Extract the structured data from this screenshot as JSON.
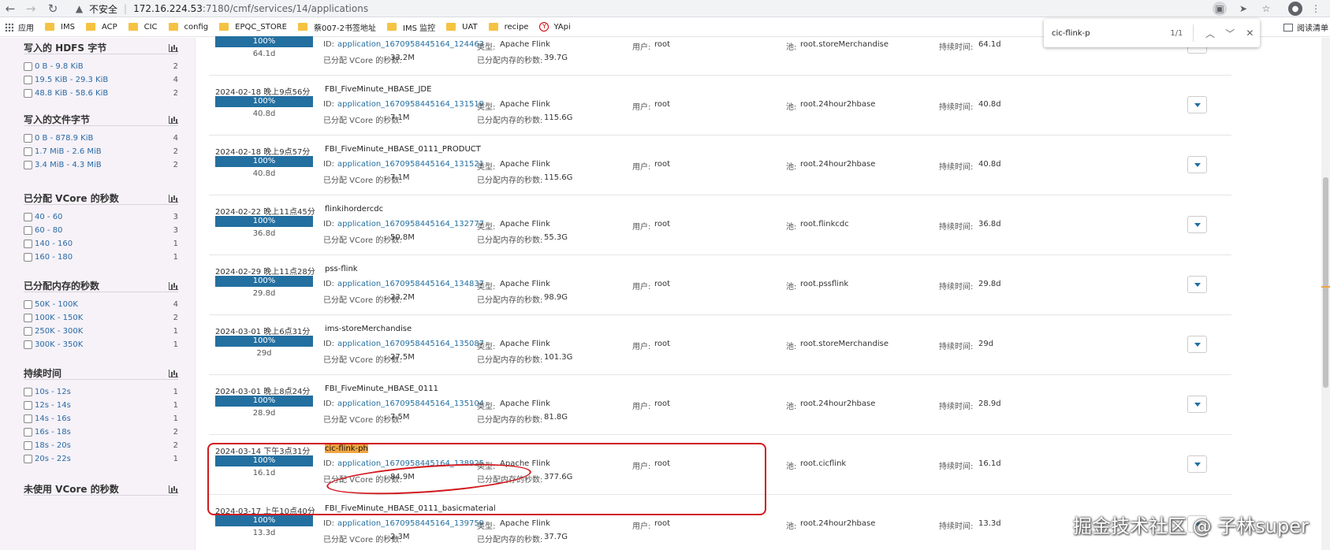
{
  "browser": {
    "insecure_label": "不安全",
    "url_host": "172.16.224.53",
    "url_path": ":7180/cmf/services/14/applications",
    "bookmarks": [
      {
        "label": "应用",
        "icon": "apps-grid-icon"
      },
      {
        "label": "IMS",
        "icon": "folder-icon"
      },
      {
        "label": "ACP",
        "icon": "folder-icon"
      },
      {
        "label": "CIC",
        "icon": "folder-icon"
      },
      {
        "label": "config",
        "icon": "folder-icon"
      },
      {
        "label": "EPQC_STORE",
        "icon": "folder-icon"
      },
      {
        "label": "蔡007-2书签地址",
        "icon": "folder-icon"
      },
      {
        "label": "IMS 监控",
        "icon": "folder-icon"
      },
      {
        "label": "UAT",
        "icon": "folder-icon"
      },
      {
        "label": "recipe",
        "icon": "folder-icon"
      },
      {
        "label": "YApi",
        "icon": "yapi-icon"
      }
    ],
    "reading_list": "阅读清单",
    "find": {
      "query": "cic-flink-p",
      "count": "1/1"
    }
  },
  "facets": [
    {
      "title": "写入的 HDFS 字节",
      "items": [
        {
          "label": "0 B - 9.8 KiB",
          "count": "2"
        },
        {
          "label": "19.5 KiB - 29.3 KiB",
          "count": "4"
        },
        {
          "label": "48.8 KiB - 58.6 KiB",
          "count": "2"
        }
      ]
    },
    {
      "title": "写入的文件字节",
      "items": [
        {
          "label": "0 B - 878.9 KiB",
          "count": "4"
        },
        {
          "label": "1.7 MiB - 2.6 MiB",
          "count": "2"
        },
        {
          "label": "3.4 MiB - 4.3 MiB",
          "count": "2"
        }
      ]
    },
    {
      "title": "已分配 VCore 的秒数",
      "items": [
        {
          "label": "40 - 60",
          "count": "3"
        },
        {
          "label": "60 - 80",
          "count": "3"
        },
        {
          "label": "140 - 160",
          "count": "1"
        },
        {
          "label": "160 - 180",
          "count": "1"
        }
      ]
    },
    {
      "title": "已分配内存的秒数",
      "items": [
        {
          "label": "50K - 100K",
          "count": "4"
        },
        {
          "label": "100K - 150K",
          "count": "2"
        },
        {
          "label": "250K - 300K",
          "count": "1"
        },
        {
          "label": "300K - 350K",
          "count": "1"
        }
      ]
    },
    {
      "title": "持续时间",
      "items": [
        {
          "label": "10s - 12s",
          "count": "1"
        },
        {
          "label": "12s - 14s",
          "count": "1"
        },
        {
          "label": "14s - 16s",
          "count": "1"
        },
        {
          "label": "16s - 18s",
          "count": "2"
        },
        {
          "label": "18s - 20s",
          "count": "2"
        },
        {
          "label": "20s - 22s",
          "count": "1"
        }
      ]
    },
    {
      "title": "未使用 VCore 的秒数",
      "items": []
    }
  ],
  "labels": {
    "id": "ID:",
    "type": "类型:",
    "vcore": "已分配 VCore 的秒数:",
    "memory": "已分配内存的秒数:",
    "user": "用户:",
    "pool": "池:",
    "duration": "持续时间:"
  },
  "apps": [
    {
      "start": "",
      "progress": "100%",
      "progress_value": 100,
      "elapsed": "64.1d",
      "name": "",
      "id": "application_1670958445164_124463",
      "type": "Apache Flink",
      "vcore": "33.2M",
      "memory": "39.7G",
      "user": "root",
      "pool": "root.storeMerchandise",
      "duration": "64.1d"
    },
    {
      "start": "2024-02-18 晚上9点56分",
      "progress": "100%",
      "progress_value": 100,
      "elapsed": "40.8d",
      "name": "FBI_FiveMinute_HBASE_JDE",
      "id": "application_1670958445164_131519",
      "type": "Apache Flink",
      "vcore": "7.1M",
      "memory": "115.6G",
      "user": "root",
      "pool": "root.24hour2hbase",
      "duration": "40.8d"
    },
    {
      "start": "2024-02-18 晚上9点57分",
      "progress": "100%",
      "progress_value": 100,
      "elapsed": "40.8d",
      "name": "FBI_FiveMinute_HBASE_0111_PRODUCT",
      "id": "application_1670958445164_131521",
      "type": "Apache Flink",
      "vcore": "7.1M",
      "memory": "115.6G",
      "user": "root",
      "pool": "root.24hour2hbase",
      "duration": "40.8d"
    },
    {
      "start": "2024-02-22 晚上11点45分",
      "progress": "100%",
      "progress_value": 100,
      "elapsed": "36.8d",
      "name": "flinkihordercdc",
      "id": "application_1670958445164_132777",
      "type": "Apache Flink",
      "vcore": "50.8M",
      "memory": "55.3G",
      "user": "root",
      "pool": "root.flinkcdc",
      "duration": "36.8d"
    },
    {
      "start": "2024-02-29 晚上11点28分",
      "progress": "100%",
      "progress_value": 100,
      "elapsed": "29.8d",
      "name": "pss-flink",
      "id": "application_1670958445164_134837",
      "type": "Apache Flink",
      "vcore": "23.2M",
      "memory": "98.9G",
      "user": "root",
      "pool": "root.pssflink",
      "duration": "29.8d"
    },
    {
      "start": "2024-03-01 晚上6点31分",
      "progress": "100%",
      "progress_value": 100,
      "elapsed": "29d",
      "name": "ims-storeMerchandise",
      "id": "application_1670958445164_135087",
      "type": "Apache Flink",
      "vcore": "27.5M",
      "memory": "101.3G",
      "user": "root",
      "pool": "root.storeMerchandise",
      "duration": "29d"
    },
    {
      "start": "2024-03-01 晚上8点24分",
      "progress": "100%",
      "progress_value": 100,
      "elapsed": "28.9d",
      "name": "FBI_FiveMinute_HBASE_0111",
      "id": "application_1670958445164_135104",
      "type": "Apache Flink",
      "vcore": "7.5M",
      "memory": "81.8G",
      "user": "root",
      "pool": "root.24hour2hbase",
      "duration": "28.9d"
    },
    {
      "start": "2024-03-14 下午3点31分",
      "progress": "100%",
      "progress_value": 100,
      "elapsed": "16.1d",
      "name": "cic-flink-ph",
      "id": "application_1670958445164_138925",
      "type": "Apache Flink",
      "vcore": "84.9M",
      "memory": "377.6G",
      "user": "root",
      "pool": "root.cicflink",
      "duration": "16.1d",
      "highlight": true
    },
    {
      "start": "2024-03-17 上午10点40分",
      "progress": "100%",
      "progress_value": 100,
      "elapsed": "13.3d",
      "name": "FBI_FiveMinute_HBASE_0111_basicmaterial",
      "id": "application_1670958445164_139759",
      "type": "Apache Flink",
      "vcore": "2.3M",
      "memory": "37.7G",
      "user": "root",
      "pool": "root.24hour2hbase",
      "duration": "13.3d"
    }
  ],
  "watermark": "掘金技术社区 @ 子林super",
  "colors": {
    "accent": "#236fa0",
    "annotation": "#d0191f",
    "highlight": "#f0a541"
  }
}
